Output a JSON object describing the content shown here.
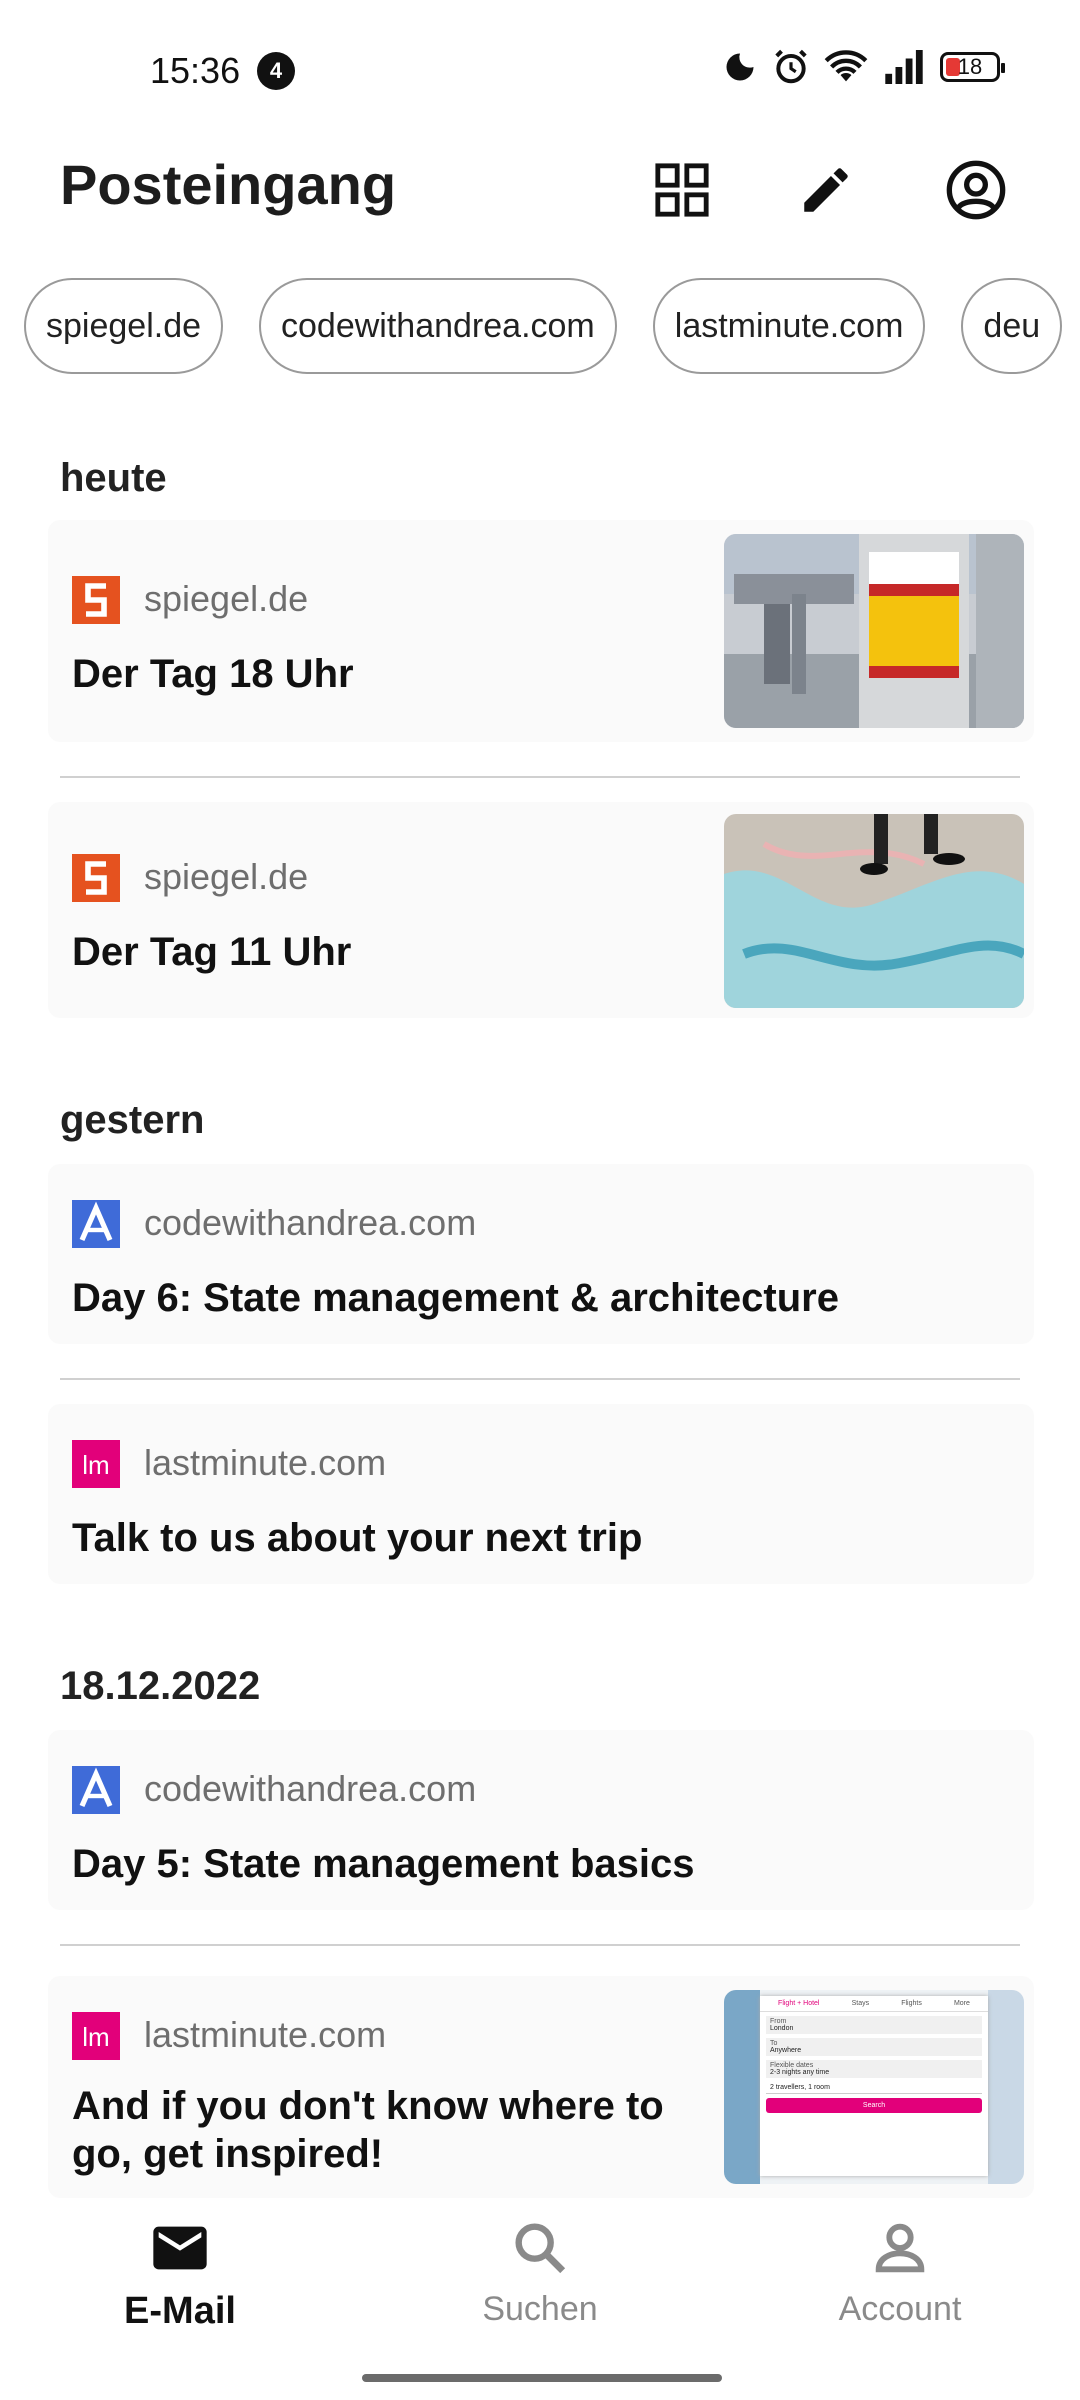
{
  "status": {
    "time": "15:36",
    "notifications": "4",
    "battery": "18"
  },
  "header": {
    "title": "Posteingang"
  },
  "chips": [
    "spiegel.de",
    "codewithandrea.com",
    "lastminute.com",
    "deu"
  ],
  "sections": [
    {
      "label": "heute",
      "emails": [
        {
          "source": "spiegel.de",
          "subject": "Der Tag 18 Uhr",
          "icon": "spiegel-icon"
        },
        {
          "source": "spiegel.de",
          "subject": "Der Tag 11 Uhr",
          "icon": "spiegel-icon"
        }
      ]
    },
    {
      "label": "gestern",
      "emails": [
        {
          "source": "codewithandrea.com",
          "subject": "Day 6: State management & architecture",
          "icon": "codewithandrea-icon"
        },
        {
          "source": "lastminute.com",
          "subject": "Talk to us about your next trip",
          "icon": "lastminute-icon"
        }
      ]
    },
    {
      "label": "18.12.2022",
      "emails": [
        {
          "source": "codewithandrea.com",
          "subject": "Day 5: State management basics",
          "icon": "codewithandrea-icon"
        },
        {
          "source": "lastminute.com",
          "subject": "And if you don't know where to go, get inspired!",
          "icon": "lastminute-icon"
        }
      ]
    }
  ],
  "thumbnail_lastminute": {
    "tabs": [
      "Flight + Hotel",
      "Stays",
      "Flights",
      "More"
    ],
    "from_label": "From",
    "from_value": "London",
    "to_label": "To",
    "to_value": "Anywhere",
    "dates_label": "Flexible dates",
    "dates_value": "2-3 nights any time",
    "travellers": "2 travellers, 1 room",
    "search": "Search"
  },
  "nav": [
    {
      "label": "E-Mail",
      "icon": "mail-icon",
      "active": true
    },
    {
      "label": "Suchen",
      "icon": "search-icon",
      "active": false
    },
    {
      "label": "Account",
      "icon": "person-icon",
      "active": false
    }
  ],
  "colors": {
    "spiegel": "#e5521f",
    "codewithandrea": "#3f6bd8",
    "lastminute": "#e2007a",
    "inactive": "#8a8a8a"
  }
}
